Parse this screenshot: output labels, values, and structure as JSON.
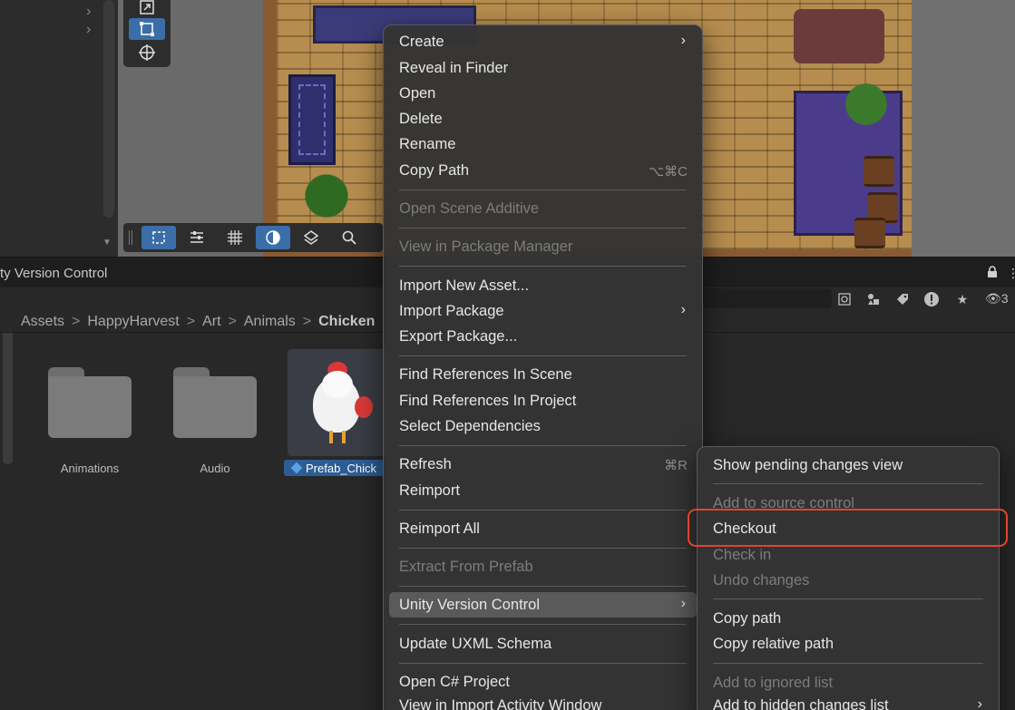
{
  "scene": {
    "tools": [
      "scale-tool",
      "rect-tool",
      "transform-tool"
    ],
    "toolbar": [
      "rect-select",
      "align",
      "grid",
      "circle",
      "layers",
      "search"
    ]
  },
  "project_window": {
    "title": "ty Version Control",
    "hidden_count": "3",
    "breadcrumb": [
      "Assets",
      "HappyHarvest",
      "Art",
      "Animals",
      "Chicken"
    ],
    "assets": [
      {
        "name": "Animations",
        "type": "folder"
      },
      {
        "name": "Audio",
        "type": "folder"
      },
      {
        "name": "Prefab_Chick",
        "type": "prefab",
        "selected": true
      }
    ]
  },
  "context_menu": {
    "items": [
      {
        "label": "Create",
        "submenu": true
      },
      {
        "label": "Reveal in Finder"
      },
      {
        "label": "Open"
      },
      {
        "label": "Delete"
      },
      {
        "label": "Rename"
      },
      {
        "label": "Copy Path",
        "shortcut": "⌥⌘C"
      },
      {
        "label": "Open Scene Additive",
        "disabled": true
      },
      {
        "label": "View in Package Manager",
        "disabled": true
      },
      {
        "label": "Import New Asset..."
      },
      {
        "label": "Import Package",
        "submenu": true
      },
      {
        "label": "Export Package..."
      },
      {
        "label": "Find References In Scene"
      },
      {
        "label": "Find References In Project"
      },
      {
        "label": "Select Dependencies"
      },
      {
        "label": "Refresh",
        "shortcut": "⌘R"
      },
      {
        "label": "Reimport"
      },
      {
        "label": "Reimport All"
      },
      {
        "label": "Extract From Prefab",
        "disabled": true
      },
      {
        "label": "Unity Version Control",
        "submenu": true,
        "highlighted": true
      },
      {
        "label": "Update UXML Schema"
      },
      {
        "label": "Open C# Project"
      },
      {
        "label": "View in Import Activity Window"
      }
    ]
  },
  "submenu": {
    "items": [
      {
        "label": "Show pending changes view"
      },
      {
        "label": "Add to source control",
        "disabled": true
      },
      {
        "label": "Checkout"
      },
      {
        "label": "Check in",
        "disabled": true
      },
      {
        "label": "Undo changes",
        "disabled": true
      },
      {
        "label": "Copy path"
      },
      {
        "label": "Copy relative path"
      },
      {
        "label": "Add to ignored list",
        "disabled": true
      },
      {
        "label": "Add to hidden changes list",
        "submenu": true
      }
    ]
  },
  "colors": {
    "menu_bg": "#343434",
    "highlight_ring": "#e0442f",
    "selection": "#2c5d94",
    "active_tool": "#3b6ea8"
  }
}
